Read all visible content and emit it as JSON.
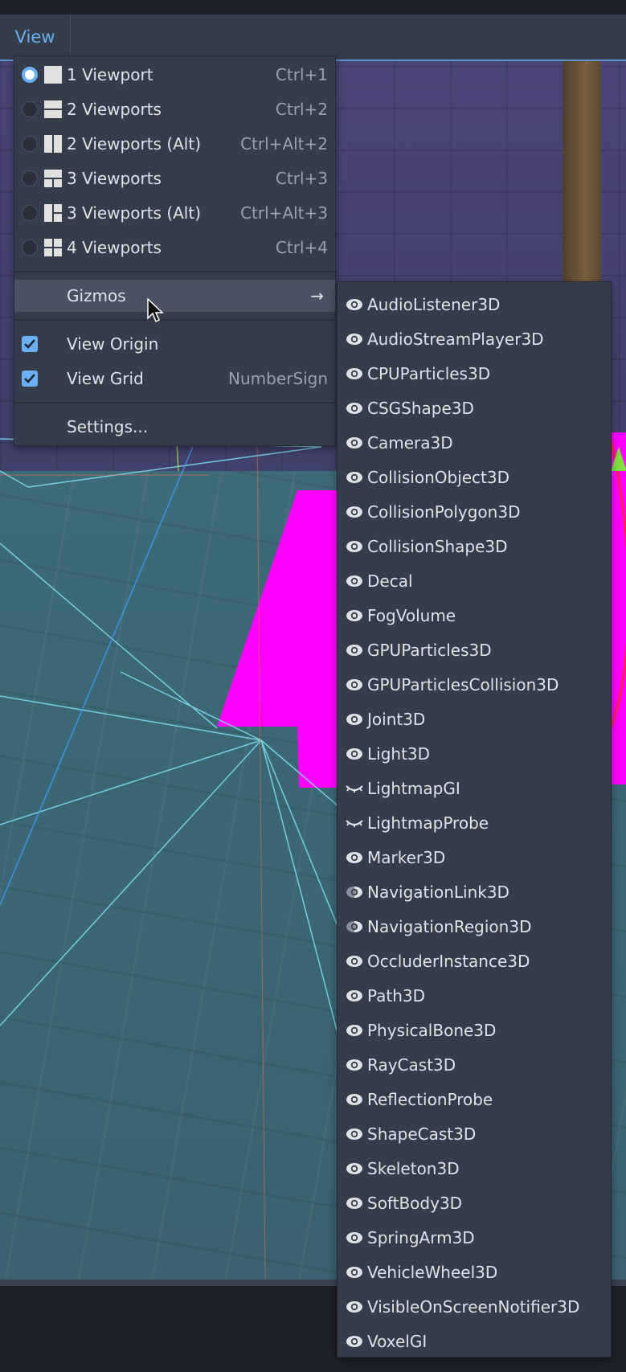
{
  "menubar": {
    "view_label": "View"
  },
  "view_menu": {
    "viewport_items": [
      {
        "label": "1 Viewport",
        "shortcut": "Ctrl+1",
        "selected": true,
        "icon": "viewport-1-icon"
      },
      {
        "label": "2 Viewports",
        "shortcut": "Ctrl+2",
        "selected": false,
        "icon": "viewport-2-icon"
      },
      {
        "label": "2 Viewports (Alt)",
        "shortcut": "Ctrl+Alt+2",
        "selected": false,
        "icon": "viewport-2-alt-icon"
      },
      {
        "label": "3 Viewports",
        "shortcut": "Ctrl+3",
        "selected": false,
        "icon": "viewport-3-icon"
      },
      {
        "label": "3 Viewports (Alt)",
        "shortcut": "Ctrl+Alt+3",
        "selected": false,
        "icon": "viewport-3-alt-icon"
      },
      {
        "label": "4 Viewports",
        "shortcut": "Ctrl+4",
        "selected": false,
        "icon": "viewport-4-icon"
      }
    ],
    "gizmos_label": "Gizmos",
    "gizmos_arrow": "→",
    "view_origin_label": "View Origin",
    "view_origin_checked": true,
    "view_grid_label": "View Grid",
    "view_grid_shortcut": "NumberSign",
    "view_grid_checked": true,
    "settings_label": "Settings..."
  },
  "gizmos_menu": {
    "items": [
      {
        "label": "AudioListener3D",
        "icon": "eye-open-icon"
      },
      {
        "label": "AudioStreamPlayer3D",
        "icon": "eye-open-icon"
      },
      {
        "label": "CPUParticles3D",
        "icon": "eye-open-icon"
      },
      {
        "label": "CSGShape3D",
        "icon": "eye-open-icon"
      },
      {
        "label": "Camera3D",
        "icon": "eye-open-icon"
      },
      {
        "label": "CollisionObject3D",
        "icon": "eye-open-icon"
      },
      {
        "label": "CollisionPolygon3D",
        "icon": "eye-open-icon"
      },
      {
        "label": "CollisionShape3D",
        "icon": "eye-open-icon"
      },
      {
        "label": "Decal",
        "icon": "eye-open-icon"
      },
      {
        "label": "FogVolume",
        "icon": "eye-open-icon"
      },
      {
        "label": "GPUParticles3D",
        "icon": "eye-open-icon"
      },
      {
        "label": "GPUParticlesCollision3D",
        "icon": "eye-open-icon"
      },
      {
        "label": "Joint3D",
        "icon": "eye-open-icon"
      },
      {
        "label": "Light3D",
        "icon": "eye-open-icon"
      },
      {
        "label": "LightmapGI",
        "icon": "eye-closed-icon"
      },
      {
        "label": "LightmapProbe",
        "icon": "eye-closed-icon"
      },
      {
        "label": "Marker3D",
        "icon": "eye-open-icon"
      },
      {
        "label": "NavigationLink3D",
        "icon": "eye-half-icon"
      },
      {
        "label": "NavigationRegion3D",
        "icon": "eye-half-icon"
      },
      {
        "label": "OccluderInstance3D",
        "icon": "eye-open-icon"
      },
      {
        "label": "Path3D",
        "icon": "eye-open-icon"
      },
      {
        "label": "PhysicalBone3D",
        "icon": "eye-open-icon"
      },
      {
        "label": "RayCast3D",
        "icon": "eye-open-icon"
      },
      {
        "label": "ReflectionProbe",
        "icon": "eye-open-icon"
      },
      {
        "label": "ShapeCast3D",
        "icon": "eye-open-icon"
      },
      {
        "label": "Skeleton3D",
        "icon": "eye-open-icon"
      },
      {
        "label": "SoftBody3D",
        "icon": "eye-open-icon"
      },
      {
        "label": "SpringArm3D",
        "icon": "eye-open-icon"
      },
      {
        "label": "VehicleWheel3D",
        "icon": "eye-open-icon"
      },
      {
        "label": "VisibleOnScreenNotifier3D",
        "icon": "eye-open-icon"
      },
      {
        "label": "VoxelGI",
        "icon": "eye-open-icon"
      }
    ]
  },
  "colors": {
    "accent": "#6ab0f3",
    "menu_bg": "#363d4a",
    "hover_bg": "#4a5160",
    "magenta_mesh": "#ff00ff"
  }
}
